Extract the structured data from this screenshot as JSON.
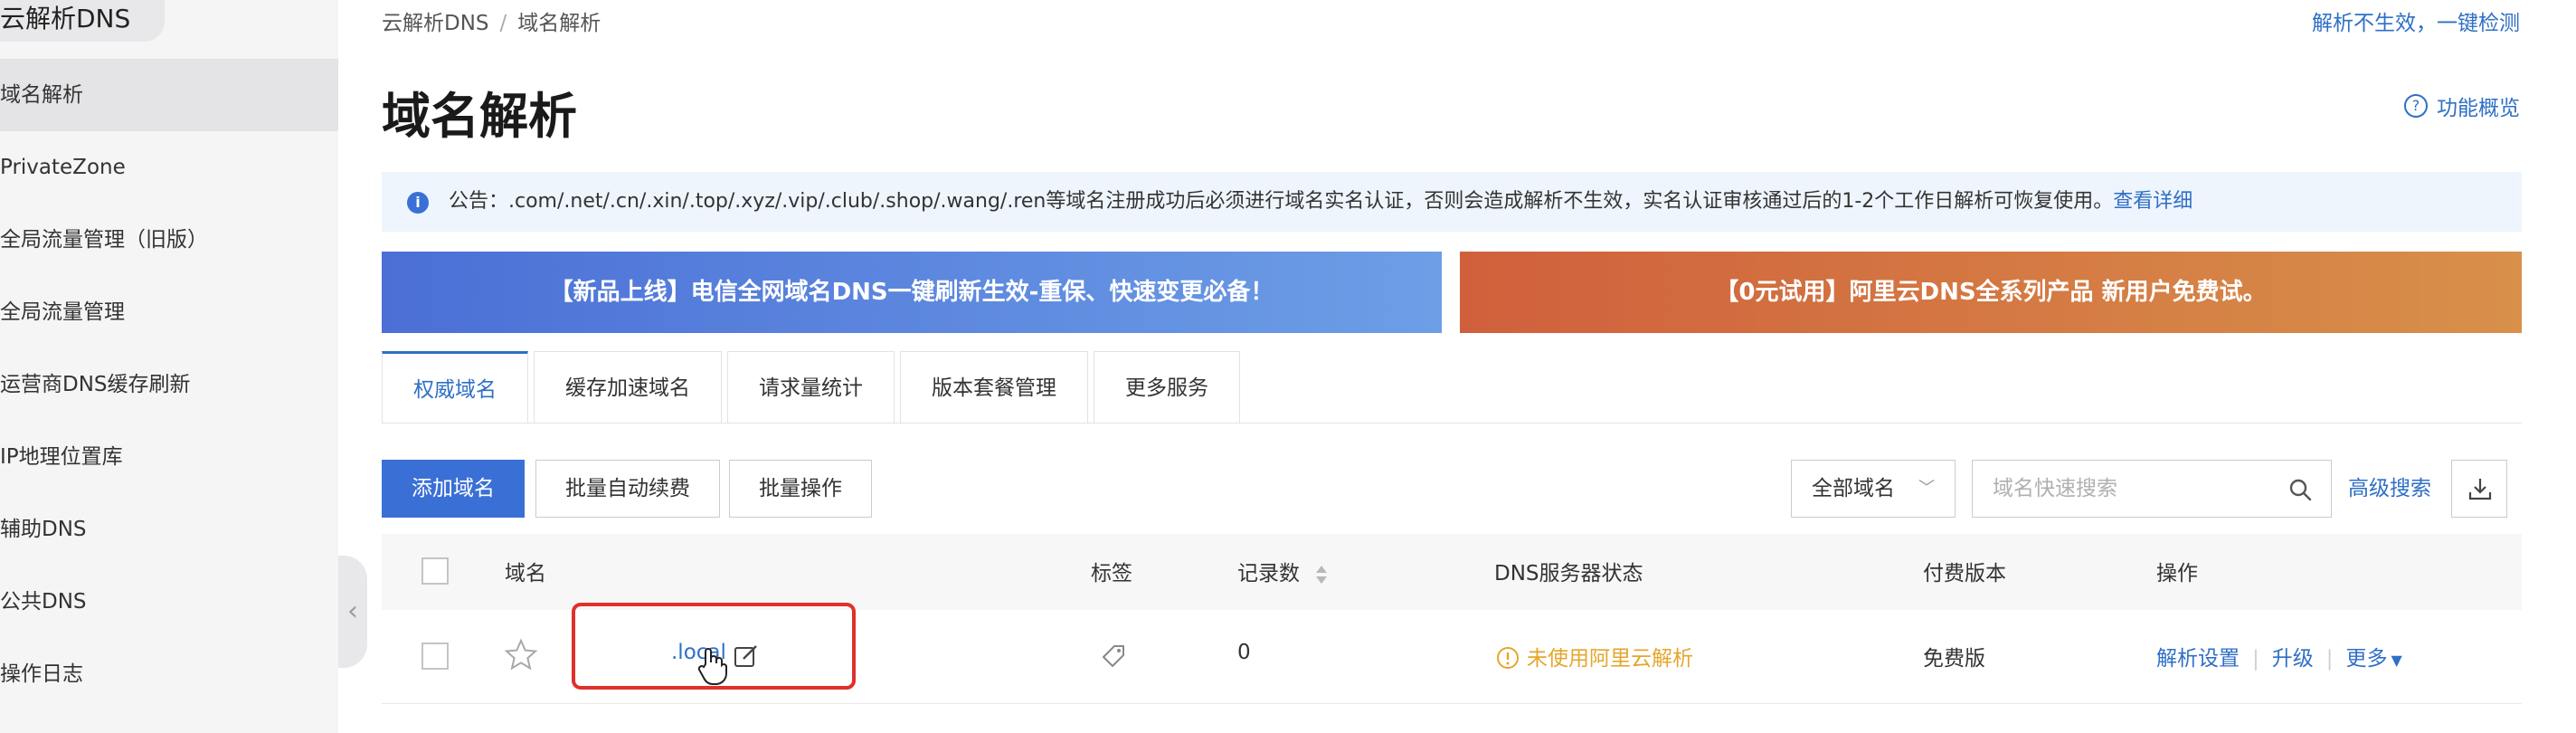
{
  "sidebar": {
    "title": "云解析DNS",
    "items": [
      {
        "label": "域名解析",
        "active": true
      },
      {
        "label": "PrivateZone"
      },
      {
        "label": "全局流量管理（旧版）"
      },
      {
        "label": "全局流量管理"
      },
      {
        "label": "运营商DNS缓存刷新"
      },
      {
        "label": "IP地理位置库"
      },
      {
        "label": "辅助DNS"
      },
      {
        "label": "公共DNS"
      },
      {
        "label": "操作日志"
      }
    ]
  },
  "breadcrumb": {
    "root": "云解析DNS",
    "separator": "/",
    "current": "域名解析"
  },
  "top_link": "解析不生效，一键检测",
  "page_title": "域名解析",
  "help_label": "功能概览",
  "notice": {
    "text": "公告：.com/.net/.cn/.xin/.top/.xyz/.vip/.club/.shop/.wang/.ren等域名注册成功后必须进行域名实名认证，否则会造成解析不生效，实名认证审核通过后的1-2个工作日解析可恢复使用。",
    "link": "查看详细"
  },
  "banners": {
    "left": "【新品上线】电信全网域名DNS一键刷新生效-重保、快速变更必备！",
    "right": "【0元试用】阿里云DNS全系列产品 新用户免费试。"
  },
  "tabs": [
    "权威域名",
    "缓存加速域名",
    "请求量统计",
    "版本套餐管理",
    "更多服务"
  ],
  "toolbar": {
    "add": "添加域名",
    "renew": "批量自动续费",
    "batch": "批量操作",
    "filter": "全部域名",
    "search_placeholder": "域名快速搜索",
    "advanced": "高级搜索"
  },
  "table": {
    "headers": {
      "domain": "域名",
      "tag": "标签",
      "records": "记录数",
      "dns_status": "DNS服务器状态",
      "edition": "付费版本",
      "actions": "操作"
    },
    "rows": [
      {
        "domain": ".local",
        "records": "0",
        "dns_status": "未使用阿里云解析",
        "edition": "免费版",
        "actions": {
          "settings": "解析设置",
          "upgrade": "升级",
          "more": "更多"
        }
      }
    ]
  },
  "colors": {
    "accent": "#2f6fc6",
    "primary_button": "#3a70d6",
    "warning": "#e5a62c",
    "highlight": "#e0302a"
  }
}
